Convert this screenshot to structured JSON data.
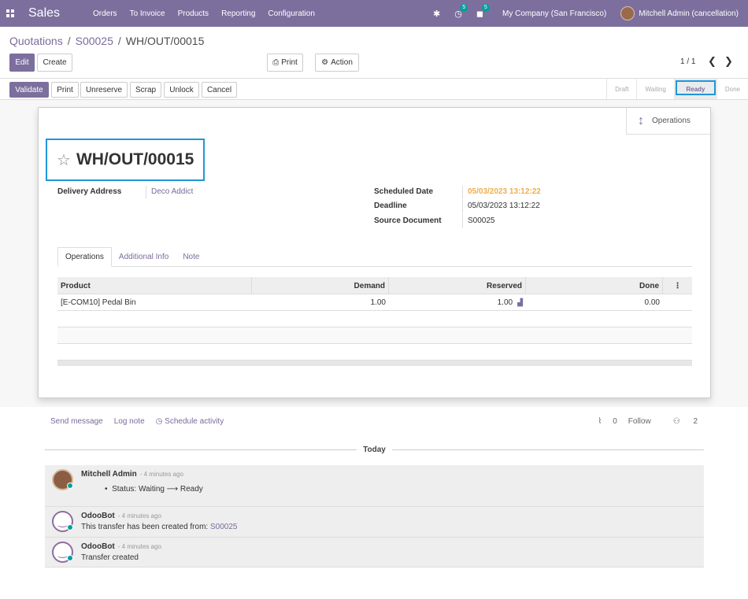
{
  "navbar": {
    "brand": "Sales",
    "menu": [
      "Orders",
      "To Invoice",
      "Products",
      "Reporting",
      "Configuration"
    ],
    "activity_count": "5",
    "message_count": "5",
    "company": "My Company (San Francisco)",
    "user": "Mitchell Admin (cancellation)"
  },
  "breadcrumb": {
    "items": [
      "Quotations",
      "S00025"
    ],
    "current": "WH/OUT/00015"
  },
  "control": {
    "edit": "Edit",
    "create": "Create",
    "print": "Print",
    "action": "Action",
    "pager": "1 / 1"
  },
  "statusbar": {
    "buttons": [
      "Validate",
      "Print",
      "Unreserve",
      "Scrap",
      "Unlock",
      "Cancel"
    ],
    "stages": [
      "Draft",
      "Waiting",
      "Ready",
      "Done"
    ],
    "current_stage": "Ready"
  },
  "sheet": {
    "smart_button": "Operations",
    "title": "WH/OUT/00015",
    "delivery_address_label": "Delivery Address",
    "delivery_address": "Deco Addict",
    "scheduled_date_label": "Scheduled Date",
    "scheduled_date": "05/03/2023 13:12:22",
    "deadline_label": "Deadline",
    "deadline": "05/03/2023 13:12:22",
    "source_document_label": "Source Document",
    "source_document": "S00025",
    "tabs": [
      "Operations",
      "Additional Info",
      "Note"
    ],
    "table": {
      "headers": [
        "Product",
        "Demand",
        "Reserved",
        "Done"
      ],
      "rows": [
        {
          "product": "[E-COM10] Pedal Bin",
          "demand": "1.00",
          "reserved": "1.00",
          "done": "0.00"
        }
      ]
    }
  },
  "chatter": {
    "send_message": "Send message",
    "log_note": "Log note",
    "schedule_activity": "Schedule activity",
    "attachments": "0",
    "follow": "Follow",
    "followers": "2",
    "today": "Today",
    "messages": [
      {
        "author": "Mitchell Admin",
        "time": "- 4 minutes ago",
        "body_prefix": "Status: Waiting",
        "body_suffix": "Ready"
      },
      {
        "author": "OdooBot",
        "time": "- 4 minutes ago",
        "body_prefix": "This transfer has been created from:",
        "link": "S00025"
      },
      {
        "author": "OdooBot",
        "time": "- 4 minutes ago",
        "body_prefix": "Transfer created"
      }
    ]
  },
  "colors": {
    "brand": "#7c6f9e",
    "link": "#7c6a9c",
    "highlight": "#2196d9",
    "warning": "#f0ad4e",
    "online": "#00a09d"
  }
}
